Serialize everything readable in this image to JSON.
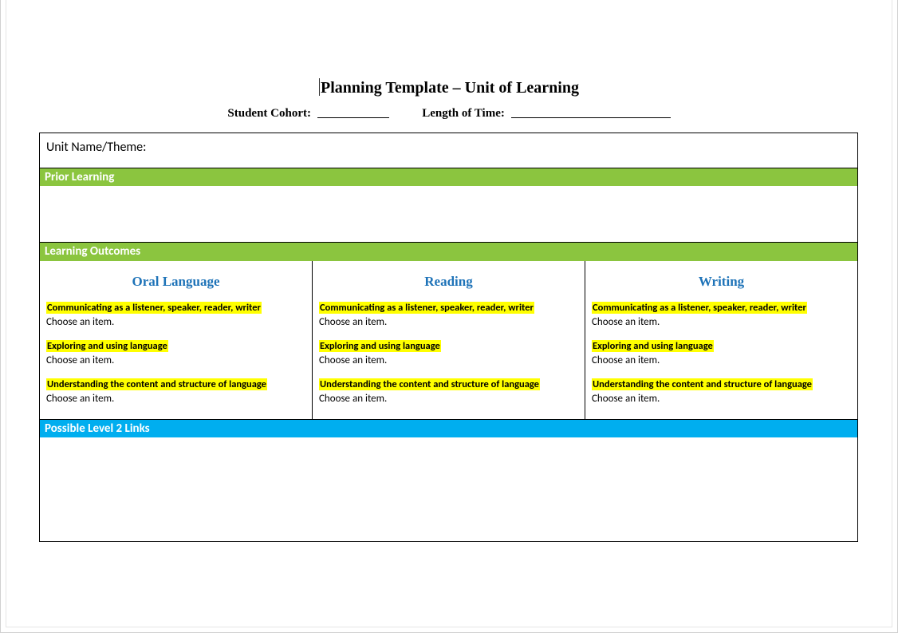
{
  "title": "Planning Template – Unit of Learning",
  "subheader": {
    "cohort_label": "Student Cohort:",
    "length_label": "Length of Time:"
  },
  "unit_name_label": "Unit Name/Theme:",
  "prior_learning_label": "Prior Learning",
  "learning_outcomes_label": "Learning Outcomes",
  "possible_level2_label": "Possible Level 2 Links",
  "columns": {
    "oral": {
      "heading": "Oral Language",
      "s1": "Communicating as a listener, speaker, reader, writer",
      "c1": "Choose an item.",
      "s2": "Exploring and using language",
      "c2": "Choose an item.",
      "s3": "Understanding the content and structure of language",
      "c3": "Choose an item."
    },
    "reading": {
      "heading": "Reading",
      "s1": "Communicating as a listener, speaker, reader, writer",
      "c1": "Choose an item.",
      "s2": "Exploring and using language",
      "c2": "Choose an item.",
      "s3": "Understanding the content and structure of language",
      "c3": "Choose an item."
    },
    "writing": {
      "heading": "Writing",
      "s1": "Communicating as a listener, speaker, reader, writer",
      "c1": "Choose an item.",
      "s2": "Exploring and using language",
      "c2": "Choose an item.",
      "s3": "Understanding the content and structure of language",
      "c3": "Choose an item."
    }
  }
}
